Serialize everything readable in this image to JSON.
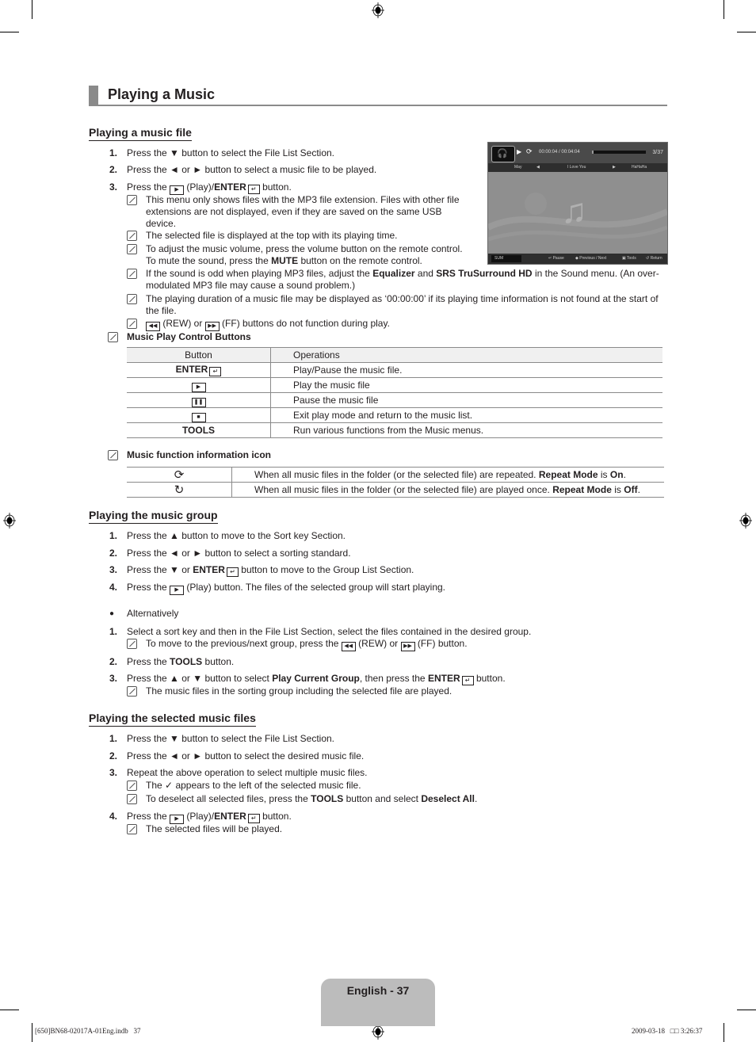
{
  "page_title": "Playing a Music",
  "sections": {
    "music_file": {
      "heading": "Playing a music file",
      "steps": [
        {
          "num": "1.",
          "pre": "Press the ▼ button to select the File List Section."
        },
        {
          "num": "2.",
          "pre": "Press the ◄ or ► button to select a music file to be played."
        },
        {
          "num": "3.",
          "pre": "Press the",
          "mid": "(Play)/",
          "bold": "ENTER",
          "post": "button."
        }
      ],
      "notes": [
        "This menu only shows files with the MP3 file extension. Files with other file extensions are not displayed, even if they are saved on the same USB device.",
        "The selected file is displayed at the top with its playing time.",
        "To adjust the music volume, press the volume button on the remote control.",
        "To mute the sound, press the",
        "MUTE",
        "button on the remote control."
      ],
      "note_equalizer": {
        "a": "If the sound is odd when playing MP3 files, adjust the",
        "b1": "Equalizer",
        "c": "and",
        "b2": "SRS TruSurround HD",
        "d": "in the Sound menu. (An over-modulated MP3 file may cause a sound problem.)"
      },
      "note_duration": "The playing duration of a music file may be displayed as ‘00:00:00’ if its playing time information is not found at the start of the file.",
      "note_rew": {
        "a": "(REW) or",
        "b": "(FF) buttons do not function during play."
      }
    },
    "control_buttons": {
      "heading": "Music Play Control Buttons",
      "columns": [
        "Button",
        "Operations"
      ],
      "rows": [
        {
          "button": "ENTER",
          "icon": "enter-icon",
          "operation": "Play/Pause the music file."
        },
        {
          "button": "",
          "icon": "play-icon",
          "operation": "Play the music file"
        },
        {
          "button": "",
          "icon": "pause-icon",
          "operation": "Pause the music file"
        },
        {
          "button": "",
          "icon": "stop-icon",
          "operation": "Exit play mode and return to the music list."
        },
        {
          "button": "TOOLS",
          "icon": "",
          "operation": "Run various functions from the Music menus."
        }
      ]
    },
    "function_icons": {
      "heading": "Music function information icon",
      "rows": [
        {
          "icon": "repeat-on-icon",
          "text": "When all music files in the folder (or the selected file) are repeated.",
          "bold1": "Repeat Mode",
          "is": "is",
          "bold2": "On",
          "end": "."
        },
        {
          "icon": "repeat-off-icon",
          "text": "When all music files in the folder (or the selected file) are played once.",
          "bold1": "Repeat Mode",
          "is": "is",
          "bold2": "Off",
          "end": "."
        }
      ]
    },
    "music_group": {
      "heading": "Playing the music group",
      "steps": [
        {
          "num": "1.",
          "text": "Press the ▲ button to move to the Sort key Section."
        },
        {
          "num": "2.",
          "text": "Press the ◄ or ► button to select a sorting standard."
        },
        {
          "num": "3.",
          "pre": "Press the ▼ or",
          "bold": "ENTER",
          "post": "button to move to the Group List Section."
        },
        {
          "num": "4.",
          "pre": "Press the",
          "post": "(Play) button. The files of the selected group will start playing."
        }
      ],
      "bullet": "Alternatively",
      "alt_steps": [
        {
          "num": "1.",
          "text": "Select a sort key and then in the File List Section, select the files contained in the desired group."
        },
        {
          "num": "2.",
          "pre": "Press the",
          "bold": "TOOLS",
          "post": "button."
        },
        {
          "num": "3.",
          "pre": "Press the ▲ or ▼ button to select",
          "bold": "Play Current Group",
          "mid": ", then press the",
          "bold2": "ENTER",
          "post": "button."
        }
      ],
      "alt_note1": {
        "a": "To move to the previous/next group, press the",
        "b": "(REW) or",
        "c": "(FF) button."
      },
      "alt_note3": "The music files in the sorting group including the selected file are played."
    },
    "selected_files": {
      "heading": "Playing the selected music files",
      "steps": [
        {
          "num": "1.",
          "text": "Press the ▼ button to select the File List Section."
        },
        {
          "num": "2.",
          "text": "Press the ◄ or ► button to select the desired music file."
        },
        {
          "num": "3.",
          "text": "Repeat the above operation to select multiple music files."
        },
        {
          "num": "4.",
          "pre": "Press the",
          "mid": "(Play)/",
          "bold": "ENTER",
          "post": "button."
        }
      ],
      "note_check": {
        "a": "The",
        "b": "appears to the left of the selected music file."
      },
      "note_deselect": {
        "a": "To deselect all selected files, press the",
        "b1": "TOOLS",
        "c": "button and select",
        "b2": "Deselect All",
        "d": "."
      },
      "note_played": "The selected files will be played."
    }
  },
  "tv_screen": {
    "time": "00:00:04 / 00:04:04",
    "progress": 0.03,
    "track_count": "3/37",
    "prev_track": "May",
    "current_track": "I Love You",
    "next_track": "HaHaHa",
    "device": "SUM",
    "controls": [
      "Pause",
      "Previous / Next",
      "Tools",
      "Return"
    ]
  },
  "footer": {
    "page_label": "English - 37",
    "file_slug": "[650]BN68-02017A-01Eng.indb   37",
    "timestamp": "2009-03-18   □□ 3:26:37"
  }
}
